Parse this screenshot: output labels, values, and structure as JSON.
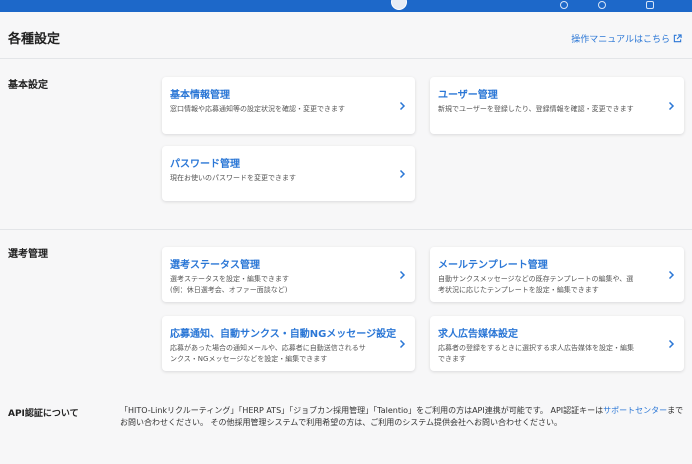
{
  "header": {
    "title": "各種設定",
    "manual_link": "操作マニュアルはこちら"
  },
  "sections": {
    "basic": {
      "label": "基本設定",
      "cards": [
        {
          "title": "基本情報管理",
          "desc": "窓口情報や応募通知等の設定状況を確認・変更できます"
        },
        {
          "title": "ユーザー管理",
          "desc": "新規でユーザーを登録したり、登録情報を確認・変更できます"
        },
        {
          "title": "パスワード管理",
          "desc": "現在お使いのパスワードを変更できます"
        }
      ]
    },
    "selection": {
      "label": "選考管理",
      "cards": [
        {
          "title": "選考ステータス管理",
          "desc": "選考ステータスを設定・編集できます",
          "desc2": "(例：休日選考会、オファー面談など)"
        },
        {
          "title": "メールテンプレート管理",
          "desc": "自動サンクスメッセージなどの既存テンプレートの編集や、選",
          "desc2": "考状況に応じたテンプレートを設定・編集できます"
        },
        {
          "title": "応募通知、自動サンクス・自動NGメッセージ設定",
          "desc": "応募があった場合の通知メールや、応募者に自動送信されるサ",
          "desc2": "ンクス・NGメッセージなどを設定・編集できます"
        },
        {
          "title": "求人広告媒体設定",
          "desc": "応募者の登録をするときに選択する求人広告媒体を設定・編集",
          "desc2": "できます"
        }
      ]
    }
  },
  "api": {
    "label": "API認証について",
    "text_before": "「HITO-Linkリクルーティング」「HERP ATS」「ジョブカン採用管理」「Talentio」をご利用の方はAPI連携が可能です。 API認証キーは",
    "support_link": "サポートセンター",
    "text_after": "までお問い合わせください。 その他採用管理システムで利用希望の方は、ご利用のシステム提供会社へお問い合わせください。"
  },
  "colors": {
    "accent": "#2b77d6",
    "topbar": "#1d68c9"
  }
}
